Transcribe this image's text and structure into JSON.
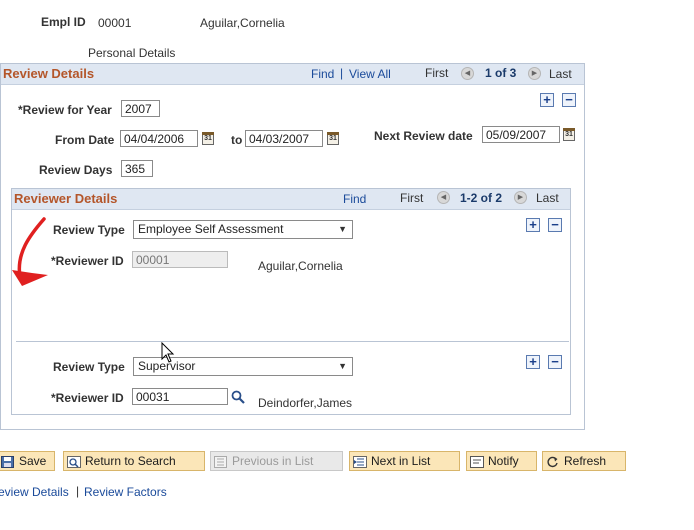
{
  "header": {
    "empl_id_label": "Empl ID",
    "empl_id": "00001",
    "empl_name": "Aguilar,Cornelia",
    "subtitle": "Personal Details"
  },
  "review": {
    "title": "Review Details",
    "find": "Find",
    "sep": "|",
    "view_all": "View All",
    "first": "First",
    "count": "1 of 3",
    "last": "Last",
    "year_label": "*Review for Year",
    "year": "2007",
    "from_label": "From Date",
    "from": "04/04/2006",
    "to_label": "to",
    "to": "04/03/2007",
    "next_label": "Next Review date",
    "next": "05/09/2007",
    "days_label": "Review Days",
    "days": "365",
    "add": "+",
    "remove": "−"
  },
  "reviewer": {
    "title": "Reviewer Details",
    "find": "Find",
    "first": "First",
    "count": "1-2 of 2",
    "last": "Last",
    "type_label": "Review Type",
    "id_label": "*Reviewer ID",
    "add": "+",
    "remove": "−",
    "rows": [
      {
        "type": "Employee Self Assessment",
        "id": "00001",
        "name": "Aguilar,Cornelia"
      },
      {
        "type": "Supervisor",
        "id": "00031",
        "name": "Deindorfer,James"
      }
    ]
  },
  "toolbar": {
    "save": "Save",
    "return": "Return to Search",
    "previous": "Previous in List",
    "next": "Next in List",
    "notify": "Notify",
    "refresh": "Refresh"
  },
  "footer": {
    "link1": "eview Details",
    "sep": "|",
    "link2": "Review Factors"
  },
  "colors": {
    "section_title": "#b4562a",
    "link": "#1a4a9a",
    "annotation_arrow": "#e02020"
  }
}
